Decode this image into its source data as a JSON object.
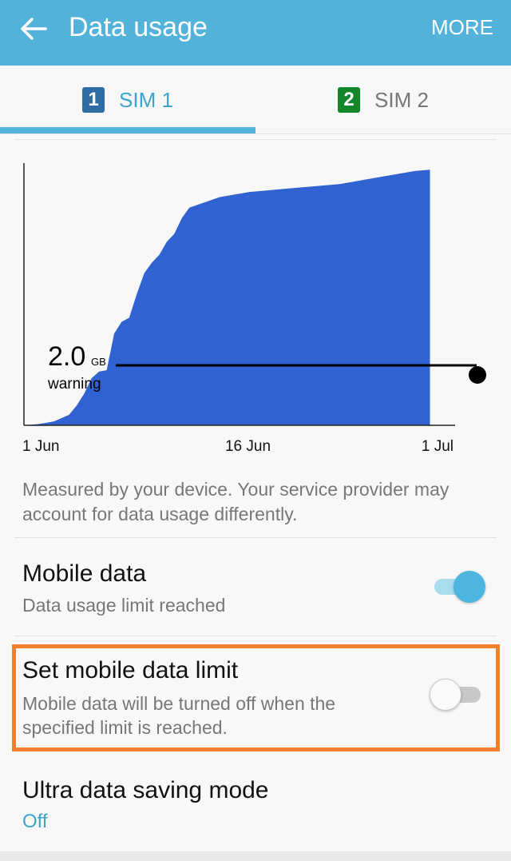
{
  "appbar": {
    "title": "Data usage",
    "more_label": "MORE",
    "accent_color": "#53b2d9",
    "back_icon": "arrow-left-icon"
  },
  "tabs": [
    {
      "badge": "1",
      "label": "SIM 1",
      "badge_color": "#2e6da4",
      "selected": true
    },
    {
      "badge": "2",
      "label": "SIM 2",
      "badge_color": "#13862c",
      "selected": false
    }
  ],
  "chart_data": {
    "type": "area",
    "x_tick_labels": [
      "1 Jun",
      "16 Jun",
      "1 Jul"
    ],
    "warning": {
      "value_label": "2.0",
      "unit": "GB",
      "text": "warning",
      "value_gb": 2.0
    },
    "fill_color": "#3062d2",
    "series": [
      {
        "x_days": [
          0,
          1,
          2,
          3,
          3.5,
          4,
          4.5,
          5,
          5.5,
          6,
          6.5,
          7,
          7.5,
          8,
          8.5,
          9,
          9.5,
          10,
          10.5,
          11,
          12,
          13,
          14,
          15,
          16,
          17,
          18,
          19,
          20,
          21,
          22,
          23,
          24,
          25,
          26,
          27
        ],
        "y_gb": [
          0.0,
          0.05,
          0.15,
          0.4,
          0.75,
          1.2,
          1.8,
          2.05,
          2.1,
          3.5,
          3.95,
          4.1,
          5.0,
          5.8,
          6.2,
          6.5,
          7.0,
          7.3,
          7.9,
          8.3,
          8.5,
          8.7,
          8.8,
          8.9,
          8.95,
          9.0,
          9.05,
          9.1,
          9.15,
          9.2,
          9.3,
          9.4,
          9.5,
          9.6,
          9.7,
          9.75
        ]
      }
    ]
  },
  "chart_note": "Measured by your device. Your service provider may account for data usage differently.",
  "mobile_data": {
    "title": "Mobile data",
    "subtitle": "Data usage limit reached",
    "enabled": true
  },
  "data_limit": {
    "title": "Set mobile data limit",
    "subtitle_line1": "Mobile data will be turned off when the",
    "subtitle_line2": "specified limit is reached.",
    "enabled": false
  },
  "ultra_saving": {
    "title": "Ultra data saving mode",
    "value": "Off"
  }
}
